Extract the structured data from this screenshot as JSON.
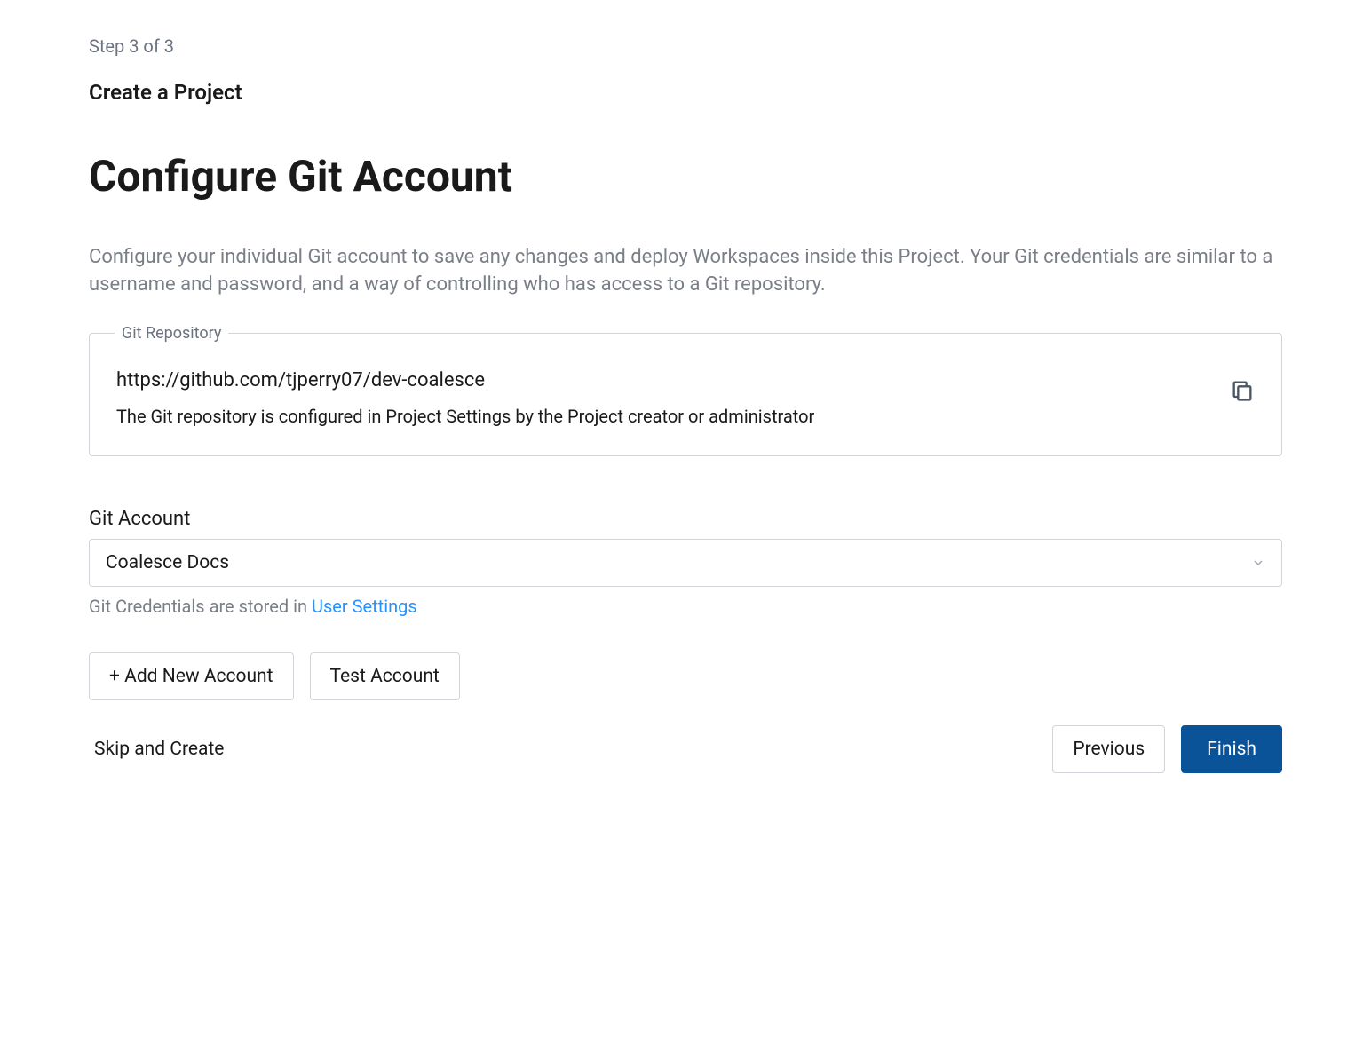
{
  "step_indicator": "Step 3 of 3",
  "page_subtitle": "Create a Project",
  "page_title": "Configure Git Account",
  "description": "Configure your individual Git account to save any changes and deploy Workspaces inside this Project. Your Git credentials are similar to a username and password, and a way of controlling who has access to a Git repository.",
  "repo": {
    "legend": "Git Repository",
    "url": "https://github.com/tjperry07/dev-coalesce",
    "note": "The Git repository is configured in Project Settings by the Project creator or administrator"
  },
  "account": {
    "label": "Git Account",
    "selected": "Coalesce Docs",
    "hint_prefix": "Git Credentials are stored in ",
    "hint_link": "User Settings"
  },
  "buttons": {
    "add_account": "+ Add New Account",
    "test_account": "Test Account",
    "skip": "Skip and Create",
    "previous": "Previous",
    "finish": "Finish"
  }
}
